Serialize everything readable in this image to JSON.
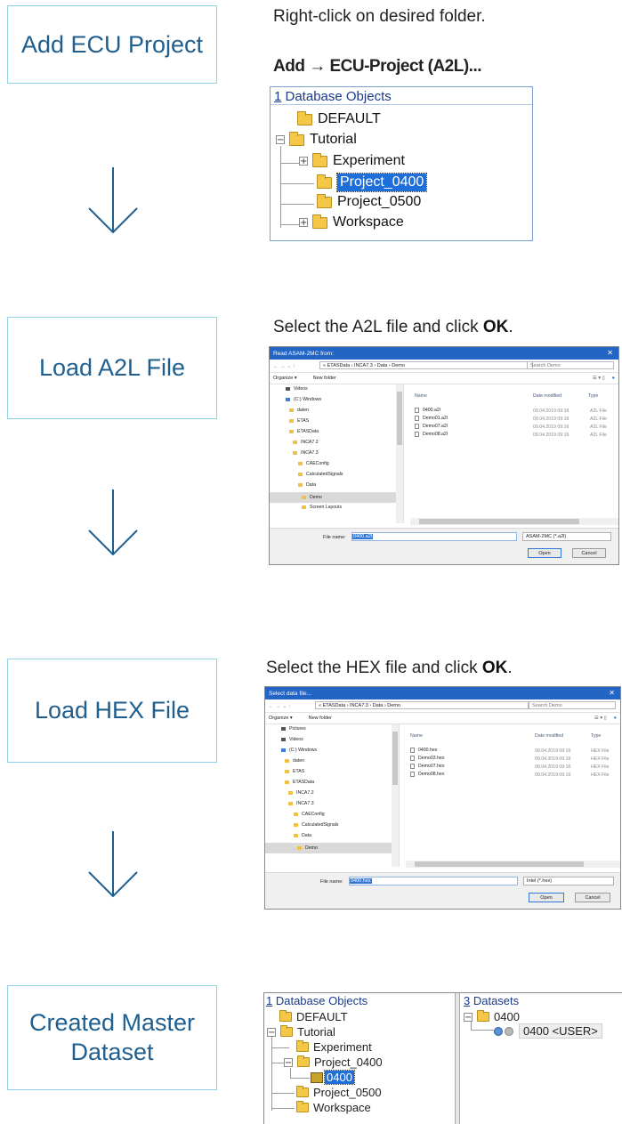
{
  "steps": [
    {
      "label": "Add ECU Project"
    },
    {
      "label": "Load A2L File"
    },
    {
      "label": "Load HEX File"
    },
    {
      "label_line1": "Created Master",
      "label_line2": "Dataset"
    }
  ],
  "step1": {
    "instruction": "Right-click on desired folder.",
    "menu_path": "Add → ECU-Project (A2L)...",
    "tree_header_num": "1",
    "tree_header_text": " Database Objects",
    "tree": [
      "DEFAULT",
      "Tutorial",
      "Experiment",
      "Project_0400",
      "Project_0500",
      "Workspace"
    ]
  },
  "step2": {
    "instruction_pre": "Select the A2L file and click ",
    "instruction_ok": "OK",
    "instruction_post": ".",
    "dialog": {
      "title": "Read ASAM-2MC from:",
      "path": "«  ETASData  ›  INCA7.3  ›  Data  ›  Demo",
      "search_placeholder": "Search Demo",
      "organize": "Organize ▾",
      "new_folder": "New folder",
      "nav": [
        "Videos",
        "(C:) Windows",
        "daten",
        "ETAS",
        "ETASData",
        "INCA7.2",
        "INCA7.3",
        "CAEConfig",
        "CalculatedSignals",
        "Data",
        "Demo",
        "Screen Layouts"
      ],
      "col_name": "Name",
      "col_date": "Date modified",
      "col_type": "Type",
      "files": [
        {
          "name": "0400.a2l",
          "date": "09.04.2019 09:16",
          "type": "A2L File"
        },
        {
          "name": "Demo01.a2l",
          "date": "09.04.2019 09:16",
          "type": "A2L File"
        },
        {
          "name": "Demo07.a2l",
          "date": "09.04.2019 09:16",
          "type": "A2L File"
        },
        {
          "name": "Demo08.a2l",
          "date": "09.04.2019 09:16",
          "type": "A2L File"
        }
      ],
      "file_name_label": "File name:",
      "file_name_value": "0400.a2l",
      "file_type": "ASAM-2MC (*.a2l)",
      "open": "Open",
      "cancel": "Cancel"
    }
  },
  "step3": {
    "instruction_pre": "Select the HEX file and click ",
    "instruction_ok": "OK",
    "instruction_post": ".",
    "dialog": {
      "title": "Select data file...",
      "path": "«  ETASData  ›  INCA7.3  ›  Data  ›  Demo",
      "search_placeholder": "Search Demo",
      "organize": "Organize ▾",
      "new_folder": "New folder",
      "nav": [
        "Pictures",
        "Videos",
        "(C:) Windows",
        "daten",
        "ETAS",
        "ETASData",
        "INCA7.2",
        "INCA7.3",
        "CAEConfig",
        "CalculatedSignals",
        "Data",
        "Demo"
      ],
      "col_name": "Name",
      "col_date": "Date modified",
      "col_type": "Type",
      "files": [
        {
          "name": "0400.hex",
          "date": "09.04.2019 09:16",
          "type": "HEX File"
        },
        {
          "name": "Demo03.hex",
          "date": "09.04.2019 09:16",
          "type": "HEX File"
        },
        {
          "name": "Demo07.hex",
          "date": "09.04.2019 09:16",
          "type": "HEX File"
        },
        {
          "name": "Demo08.hex",
          "date": "09.04.2019 09:16",
          "type": "HEX File"
        }
      ],
      "file_name_label": "File name:",
      "file_name_value": "0400.hex",
      "file_type": "Intel (*.hex)",
      "open": "Open",
      "cancel": "Cancel"
    }
  },
  "step4": {
    "left_header_num": "1",
    "left_header_text": " Database Objects",
    "left_tree": [
      "DEFAULT",
      "Tutorial",
      "Experiment",
      "Project_0400",
      "0400",
      "Project_0500",
      "Workspace"
    ],
    "right_header_num": "3",
    "right_header_text": " Datasets",
    "right_folder": "0400",
    "dataset_name": "0400",
    "dataset_tag": "<USER>"
  },
  "colors": {
    "step_border": "#8fd2ea",
    "step_text": "#1f5f8f",
    "selection": "#1e6fd9",
    "dialog_title": "#2265c4"
  }
}
